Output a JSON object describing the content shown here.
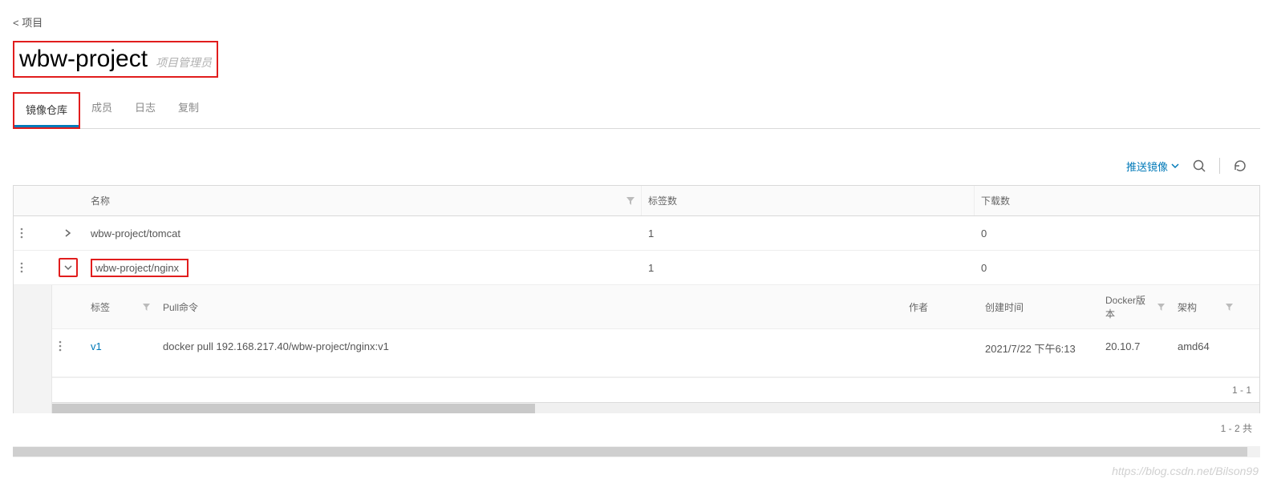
{
  "breadcrumb": {
    "back": "< 项目"
  },
  "header": {
    "title": "wbw-project",
    "role": "项目管理员"
  },
  "tabs": [
    {
      "label": "镜像仓库",
      "active": true
    },
    {
      "label": "成员"
    },
    {
      "label": "日志"
    },
    {
      "label": "复制"
    }
  ],
  "toolbar": {
    "push": "推送镜像"
  },
  "columns": {
    "name": "名称",
    "tags": "标签数",
    "downloads": "下载数"
  },
  "rows": [
    {
      "name": "wbw-project/tomcat",
      "tags": "1",
      "downloads": "0",
      "expanded": false
    },
    {
      "name": "wbw-project/nginx",
      "tags": "1",
      "downloads": "0",
      "expanded": true
    }
  ],
  "sub_columns": {
    "tag": "标签",
    "pull": "Pull命令",
    "author": "作者",
    "created": "创建时间",
    "docker": "Docker版本",
    "arch": "架构"
  },
  "sub_rows": [
    {
      "tag": "v1",
      "pull": "docker pull 192.168.217.40/wbw-project/nginx:v1",
      "author": "",
      "created": "2021/7/22 下午6:13",
      "docker": "20.10.7",
      "arch": "amd64"
    }
  ],
  "sub_footer": "1 - 1",
  "outer_footer": "1 - 2 共",
  "watermark": "https://blog.csdn.net/Bilson99"
}
